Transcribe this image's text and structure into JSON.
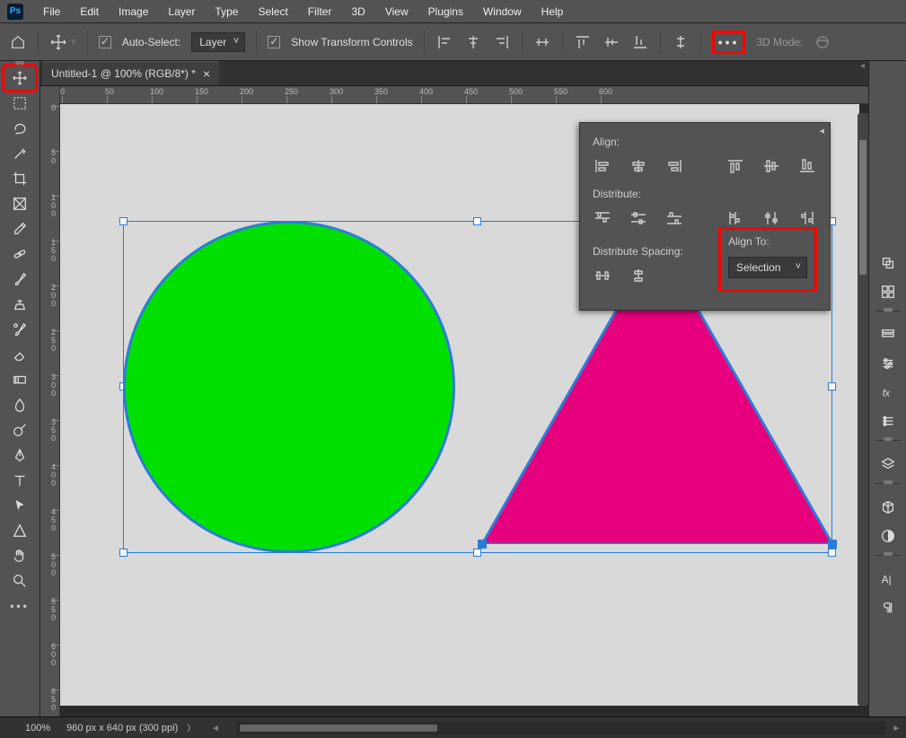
{
  "menu": {
    "items": [
      "File",
      "Edit",
      "Image",
      "Layer",
      "Type",
      "Select",
      "Filter",
      "3D",
      "View",
      "Plugins",
      "Window",
      "Help"
    ]
  },
  "options": {
    "auto_select_label": "Auto-Select:",
    "layer_dropdown": "Layer",
    "show_transform_label": "Show Transform Controls",
    "three_d_mode": "3D Mode:"
  },
  "tab": {
    "title": "Untitled-1 @ 100% (RGB/8*) *"
  },
  "panel": {
    "align_label": "Align:",
    "distribute_label": "Distribute:",
    "distribute_spacing_label": "Distribute Spacing:",
    "align_to_label": "Align To:",
    "align_to_value": "Selection"
  },
  "status": {
    "zoom": "100%",
    "docinfo": "960 px x 640 px (300 ppi)"
  },
  "ruler": {
    "h_ticks": [
      0,
      50,
      100,
      150,
      200,
      250,
      300,
      350,
      400,
      450,
      500,
      550,
      600
    ],
    "v_ticks": [
      0,
      50,
      100,
      150,
      200,
      250,
      300,
      350,
      400,
      450,
      500,
      550,
      600,
      650
    ]
  },
  "shapes": {
    "circle": {
      "fill": "#00e000",
      "stroke": "#2c7cd6"
    },
    "triangle": {
      "fill": "#e6007e",
      "stroke": "#2c7cd6"
    }
  }
}
